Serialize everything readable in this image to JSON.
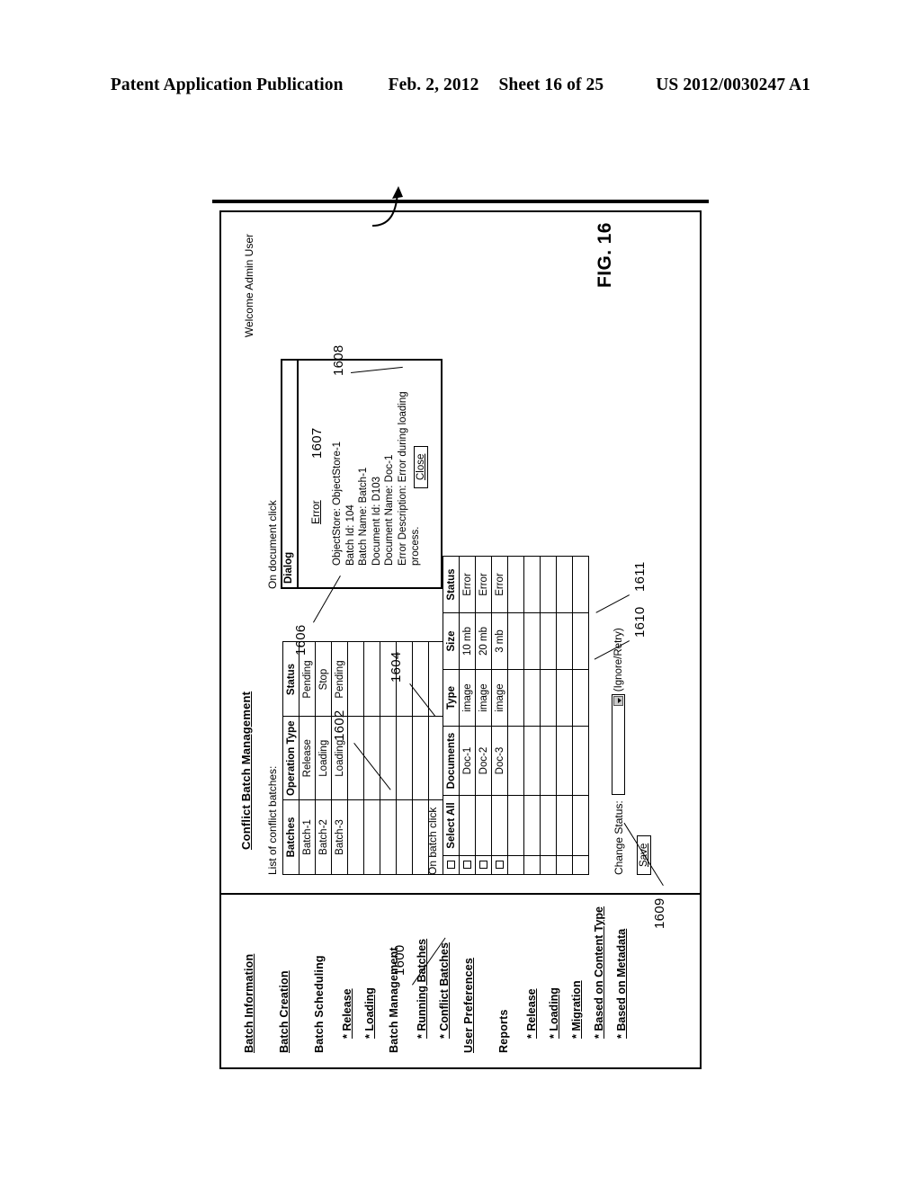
{
  "patent_header": {
    "publication": "Patent Application Publication",
    "date": "Feb. 2, 2012",
    "sheet": "Sheet 16 of 25",
    "number": "US 2012/0030247 A1"
  },
  "figure": {
    "label": "FIG. 16",
    "refs": {
      "window": "1600",
      "batches_table": "1602",
      "documents_table": "1604",
      "dialog": "1606",
      "dialog_details": "1607",
      "close_button": "1608",
      "select_checkbox": "1609",
      "status_dropdown": "1610",
      "save_button": "1611"
    }
  },
  "app": {
    "welcome": "Welcome Admin User",
    "page_title": "Conflict Batch Management"
  },
  "sidebar": {
    "groups": [
      {
        "heading": "Batch Information",
        "underline": true,
        "items": []
      },
      {
        "heading": "Batch Creation",
        "underline": true,
        "items": []
      },
      {
        "heading": "Batch Scheduling",
        "underline": false,
        "items": [
          "* Release",
          "* Loading"
        ]
      },
      {
        "heading": "Batch Management",
        "underline": false,
        "items": [
          "* Running Batches",
          "* Conflict Batches"
        ]
      },
      {
        "heading": "User Preferences",
        "underline": true,
        "items": []
      },
      {
        "heading": "Reports",
        "underline": false,
        "items": [
          "* Release",
          "* Loading",
          "* Migration",
          "* Based on Content Type",
          "* Based on Metadata"
        ]
      }
    ]
  },
  "batches": {
    "caption": "List of conflict batches:",
    "columns": [
      "Batches",
      "Operation Type",
      "Status"
    ],
    "rows": [
      [
        "Batch-1",
        "Release",
        "Pending"
      ],
      [
        "Batch-2",
        "Loading",
        "Stop"
      ],
      [
        "Batch-3",
        "Loading",
        "Pending"
      ]
    ],
    "empty_rows": 6
  },
  "documents": {
    "caption": "On batch click",
    "select_all_label": "Select All",
    "columns": [
      "Documents",
      "Type",
      "Size",
      "Status"
    ],
    "rows": [
      [
        "Doc-1",
        "image",
        "10 mb",
        "Error"
      ],
      [
        "Doc-2",
        "image",
        "20 mb",
        "Error"
      ],
      [
        "Doc-3",
        "image",
        "3 mb",
        "Error"
      ]
    ],
    "empty_rows": 5
  },
  "change_status": {
    "label": "Change Status:",
    "value": "",
    "hint": "(Ignore/Retry)",
    "options": [
      "Ignore",
      "Retry"
    ],
    "save_label": "Save"
  },
  "dialog": {
    "caption": "On document click",
    "titlebar": "Dialog",
    "heading": "Error",
    "lines": [
      "ObjectStore: ObjectStore-1",
      "Batch Id: 104",
      "Batch Name: Batch-1",
      "Document Id: D103",
      "Document Name: Doc-1",
      "Error Description: Error during loading process."
    ],
    "close_label": "Close"
  }
}
